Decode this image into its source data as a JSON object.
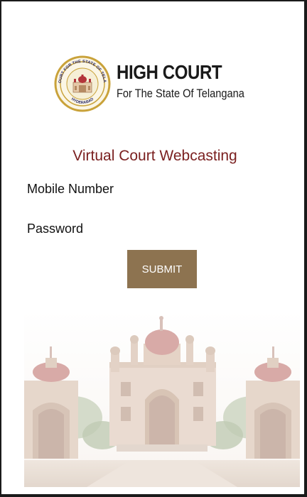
{
  "header": {
    "title_line1": "HIGH COURT",
    "title_line2": "For The State Of Telangana",
    "seal_ring_top": "HIGH COURT FOR THE STATE OF TELANGANA",
    "seal_ring_bottom": "HYDERABAD"
  },
  "page": {
    "subtitle": "Virtual Court Webcasting"
  },
  "form": {
    "mobile_label": "Mobile Number",
    "password_label": "Password",
    "submit_label": "SUBMIT"
  },
  "colors": {
    "subtitle": "#7a1f1f",
    "button": "#8d7350",
    "seal_gold": "#c9a23a"
  }
}
